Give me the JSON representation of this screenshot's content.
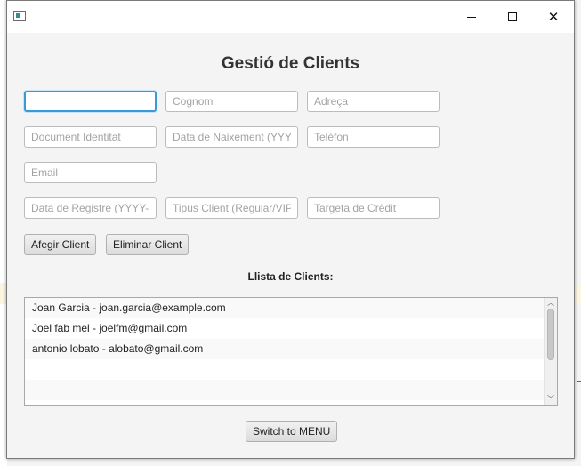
{
  "window": {
    "title_bar_icons": [
      "app-icon",
      "minimize-icon",
      "maximize-icon",
      "close-icon"
    ],
    "close_glyph": "✕"
  },
  "form": {
    "heading": "Gestió de Clients",
    "fields": {
      "nom": {
        "value": "",
        "placeholder": ""
      },
      "cognom": {
        "value": "",
        "placeholder": "Cognom"
      },
      "adreca": {
        "value": "",
        "placeholder": "Adreça"
      },
      "document": {
        "value": "",
        "placeholder": "Document Identitat"
      },
      "data_naixement": {
        "value": "",
        "placeholder": "Data de Naixement (YYYY-MM-DD)"
      },
      "telefon": {
        "value": "",
        "placeholder": "Telèfon"
      },
      "email": {
        "value": "",
        "placeholder": "Email"
      },
      "data_registre": {
        "value": "",
        "placeholder": "Data de Registre (YYYY-MM-DD)"
      },
      "tipus_client": {
        "value": "",
        "placeholder": "Tipus Client (Regular/VIP)"
      },
      "targeta": {
        "value": "",
        "placeholder": "Targeta de Crèdit"
      }
    },
    "add_button": "Afegir Client",
    "remove_button": "Eliminar Client"
  },
  "clients": {
    "title": "Llista de Clients:",
    "items": [
      "Joan Garcia - joan.garcia@example.com",
      "Joel fab mel - joelfm@gmail.com",
      "antonio lobato - alobato@gmail.com",
      "",
      ""
    ]
  },
  "footer": {
    "menu_button": "Switch to MENU"
  },
  "colors": {
    "focus_border": "#3a9ad9",
    "window_bg": "#f4f4f4"
  }
}
